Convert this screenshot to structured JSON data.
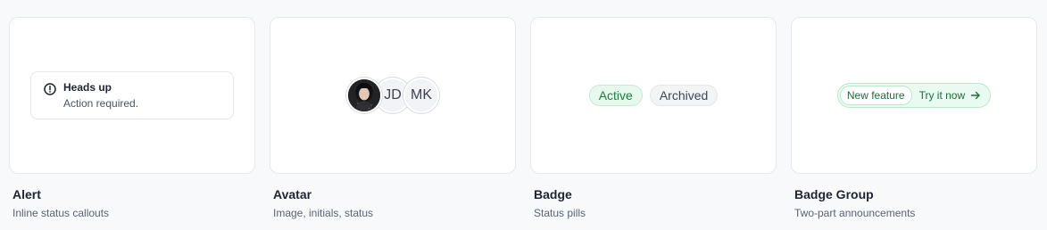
{
  "components": [
    {
      "title": "Alert",
      "description": "Inline status callouts",
      "preview": {
        "alert_title": "Heads up",
        "alert_body": "Action required.",
        "icon": "info-circle-icon"
      }
    },
    {
      "title": "Avatar",
      "description": "Image, initials, status",
      "preview": {
        "avatars": [
          {
            "type": "image",
            "alt": "photo avatar"
          },
          {
            "type": "initials",
            "text": "JD"
          },
          {
            "type": "initials",
            "text": "MK"
          }
        ]
      }
    },
    {
      "title": "Badge",
      "description": "Status pills",
      "preview": {
        "badges": [
          {
            "label": "Active",
            "color": "#1e7a43"
          },
          {
            "label": "Archived",
            "color": "#3f4553"
          }
        ]
      }
    },
    {
      "title": "Badge Group",
      "description": "Two-part announcements",
      "preview": {
        "lead": "New feature",
        "action": "Try it now",
        "icon": "arrow-right-icon",
        "color": "#1e6b3e"
      }
    }
  ]
}
